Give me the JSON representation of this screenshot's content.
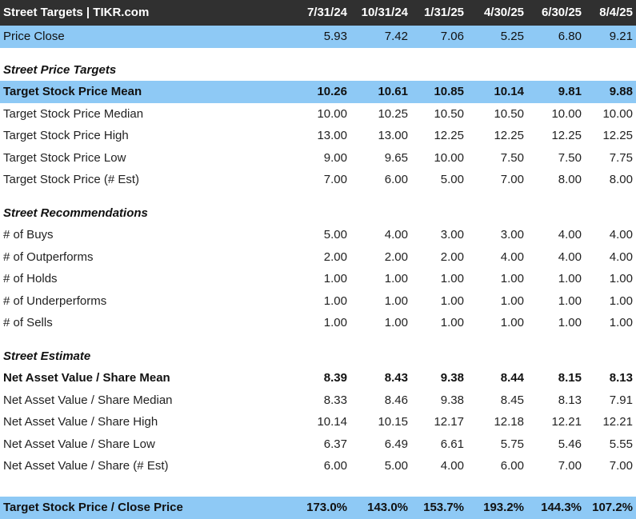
{
  "header": {
    "title": "Street Targets | TIKR.com",
    "dates": [
      "7/31/24",
      "10/31/24",
      "1/31/25",
      "4/30/25",
      "6/30/25",
      "8/4/25"
    ]
  },
  "price_close": {
    "label": "Price Close",
    "values": [
      "5.93",
      "7.42",
      "7.06",
      "5.25",
      "6.80",
      "9.21"
    ]
  },
  "sections": {
    "price_targets": {
      "title": "Street Price Targets",
      "rows": [
        {
          "label": "Target Stock Price Mean",
          "values": [
            "10.26",
            "10.61",
            "10.85",
            "10.14",
            "9.81",
            "9.88"
          ]
        },
        {
          "label": "Target Stock Price Median",
          "values": [
            "10.00",
            "10.25",
            "10.50",
            "10.50",
            "10.00",
            "10.00"
          ]
        },
        {
          "label": "Target Stock Price High",
          "values": [
            "13.00",
            "13.00",
            "12.25",
            "12.25",
            "12.25",
            "12.25"
          ]
        },
        {
          "label": "Target Stock Price Low",
          "values": [
            "9.00",
            "9.65",
            "10.00",
            "7.50",
            "7.50",
            "7.75"
          ]
        },
        {
          "label": "Target Stock Price (# Est)",
          "values": [
            "7.00",
            "6.00",
            "5.00",
            "7.00",
            "8.00",
            "8.00"
          ]
        }
      ]
    },
    "recommendations": {
      "title": "Street Recommendations",
      "rows": [
        {
          "label": "# of Buys",
          "values": [
            "5.00",
            "4.00",
            "3.00",
            "3.00",
            "4.00",
            "4.00"
          ]
        },
        {
          "label": "# of Outperforms",
          "values": [
            "2.00",
            "2.00",
            "2.00",
            "4.00",
            "4.00",
            "4.00"
          ]
        },
        {
          "label": "# of Holds",
          "values": [
            "1.00",
            "1.00",
            "1.00",
            "1.00",
            "1.00",
            "1.00"
          ]
        },
        {
          "label": "# of Underperforms",
          "values": [
            "1.00",
            "1.00",
            "1.00",
            "1.00",
            "1.00",
            "1.00"
          ]
        },
        {
          "label": "# of Sells",
          "values": [
            "1.00",
            "1.00",
            "1.00",
            "1.00",
            "1.00",
            "1.00"
          ]
        }
      ]
    },
    "estimate": {
      "title": "Street Estimate",
      "rows": [
        {
          "label": "Net Asset Value / Share Mean",
          "values": [
            "8.39",
            "8.43",
            "9.38",
            "8.44",
            "8.15",
            "8.13"
          ]
        },
        {
          "label": "Net Asset Value / Share Median",
          "values": [
            "8.33",
            "8.46",
            "9.38",
            "8.45",
            "8.13",
            "7.91"
          ]
        },
        {
          "label": "Net Asset Value / Share High",
          "values": [
            "10.14",
            "10.15",
            "12.17",
            "12.18",
            "12.21",
            "12.21"
          ]
        },
        {
          "label": "Net Asset Value / Share Low",
          "values": [
            "6.37",
            "6.49",
            "6.61",
            "5.75",
            "5.46",
            "5.55"
          ]
        },
        {
          "label": "Net Asset Value / Share (# Est)",
          "values": [
            "6.00",
            "5.00",
            "4.00",
            "6.00",
            "7.00",
            "7.00"
          ]
        }
      ]
    }
  },
  "footer": {
    "label": "Target Stock Price / Close Price",
    "values": [
      "173.0%",
      "143.0%",
      "153.7%",
      "193.2%",
      "144.3%",
      "107.2%"
    ]
  },
  "colors": {
    "header_bg": "#303030",
    "highlight_blue": "#8ec9f5"
  }
}
